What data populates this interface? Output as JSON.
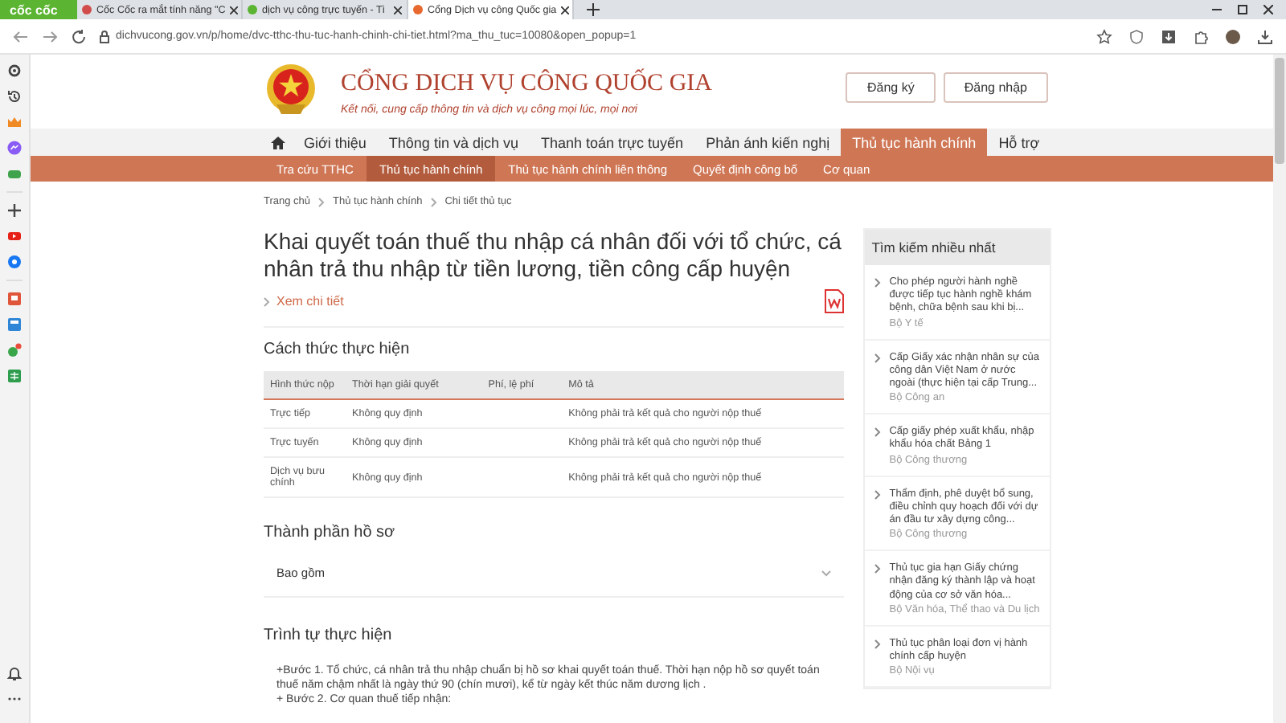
{
  "browser": {
    "brand": "cốc cốc",
    "tabs": [
      {
        "title": "Cốc Cốc ra mắt tính năng \"C",
        "selected": false
      },
      {
        "title": "dịch vụ công trực tuyến - Tì",
        "selected": false
      },
      {
        "title": "Cổng Dịch vụ công Quốc gia",
        "selected": true
      }
    ],
    "url": "dichvucong.gov.vn/p/home/dvc-tthc-thu-tuc-hanh-chinh-chi-tiet.html?ma_thu_tuc=10080&open_popup=1"
  },
  "site": {
    "title": "CỔNG DỊCH VỤ CÔNG QUỐC GIA",
    "tagline": "Kết nối, cung cấp thông tin và dịch vụ công mọi lúc, mọi nơi",
    "buttons": [
      "Đăng ký",
      "Đăng nhập"
    ],
    "nav": [
      {
        "label": "Giới thiệu",
        "selected": false
      },
      {
        "label": "Thông tin và dịch vụ",
        "selected": false
      },
      {
        "label": "Thanh toán trực tuyến",
        "selected": false
      },
      {
        "label": "Phản ánh kiến nghị",
        "selected": false
      },
      {
        "label": "Thủ tục hành chính",
        "selected": true
      },
      {
        "label": "Hỗ trợ",
        "selected": false
      }
    ],
    "subnav": [
      {
        "label": "Tra cứu TTHC",
        "selected": false
      },
      {
        "label": "Thủ tục hành chính",
        "selected": true
      },
      {
        "label": "Thủ tục hành chính liên thông",
        "selected": false
      },
      {
        "label": "Quyết định công bố",
        "selected": false
      },
      {
        "label": "Cơ quan",
        "selected": false
      }
    ],
    "breadcrumb": [
      "Trang chủ",
      "Thủ tục hành chính",
      "Chi tiết thủ tục"
    ]
  },
  "procedure": {
    "title": "Khai quyết toán thuế thu nhập cá nhân đối với tổ chức, cá nhân trả thu nhập từ tiền lương, tiền công cấp huyện",
    "more_link": "Xem chi tiết",
    "methods": {
      "heading": "Cách thức thực hiện",
      "columns": [
        "Hình thức nộp",
        "Thời hạn giải quyết",
        "Phí, lệ phí",
        "Mô tả"
      ],
      "rows": [
        [
          "Trực tiếp",
          "Không quy định",
          "",
          "Không phải trả kết quả cho người nộp thuế"
        ],
        [
          "Trực tuyến",
          "Không quy định",
          "",
          "Không phải trả kết quả cho người nộp thuế"
        ],
        [
          "Dịch vụ bưu chính",
          "Không quy định",
          "",
          "Không phải trả kết quả cho người nộp thuế"
        ]
      ]
    },
    "documents": {
      "heading": "Thành phần hồ sơ",
      "dropdown": "Bao gồm"
    },
    "steps": {
      "heading": "Trình tự thực hiện",
      "paragraphs": [
        "+Bước 1. Tổ chức, cá nhân trả thu nhập chuẩn bị hồ sơ khai quyết toán thuế. Thời hạn nộp hồ sơ quyết toán thuế năm chậm nhất là ngày thứ 90 (chín mươi), kể từ ngày kết thúc năm dương lịch .",
        "+ Bước 2. Cơ quan thuế tiếp nhận:"
      ]
    }
  },
  "most_searched": {
    "heading": "Tìm kiếm nhiều nhất",
    "items": [
      {
        "title": "Cho phép người hành nghề được tiếp tục hành nghề khám bệnh, chữa bệnh sau khi bị...",
        "agency": "Bộ Y tế"
      },
      {
        "title": "Cấp Giấy xác nhận nhân sự của công dân Việt Nam ở nước ngoài (thực hiện tại cấp Trung...",
        "agency": "Bộ Công an"
      },
      {
        "title": "Cấp giấy phép xuất khẩu, nhập khẩu hóa chất Bảng 1",
        "agency": "Bộ Công thương"
      },
      {
        "title": "Thẩm định, phê duyệt bổ sung, điều chỉnh quy hoạch đối với dự án đầu tư xây dựng công...",
        "agency": "Bộ Công thương"
      },
      {
        "title": "Thủ tục gia hạn Giấy chứng nhận đăng ký thành lập và hoạt động của cơ sở văn hóa...",
        "agency": "Bộ Văn hóa, Thể thao và Du lịch"
      },
      {
        "title": "Thủ tục phân loại đơn vị hành chính cấp huyện",
        "agency": "Bộ Nội vụ"
      }
    ]
  }
}
